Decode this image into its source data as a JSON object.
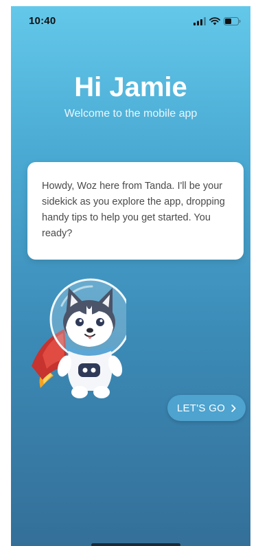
{
  "status_bar": {
    "time": "10:40",
    "icons": [
      "signal-icon",
      "wifi-icon",
      "battery-icon"
    ]
  },
  "welcome": {
    "greeting": "Hi Jamie",
    "subtitle": "Welcome to the mobile app"
  },
  "speech_card": {
    "text": "Howdy, Woz here from Tanda. I'll be your sidekick as you explore the app, dropping handy tips to help you get started. You ready?"
  },
  "mascot": {
    "icon": "husky-astronaut-mascot"
  },
  "cta": {
    "label": "LET'S GO",
    "icon": "chevron-right-icon"
  },
  "colors": {
    "background_top": "#63c8ea",
    "background_bottom": "#346f98",
    "button": "#4ea3cf",
    "card": "#ffffff"
  }
}
